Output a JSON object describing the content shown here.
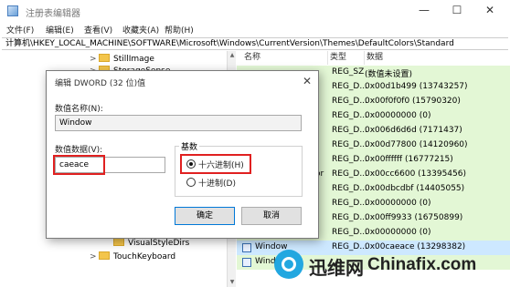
{
  "window": {
    "title": "注册表编辑器"
  },
  "menu": [
    "文件(F)",
    "编辑(E)",
    "查看(V)",
    "收藏夹(A)",
    "帮助(H)"
  ],
  "address": "计算机\\HKEY_LOCAL_MACHINE\\SOFTWARE\\Microsoft\\Windows\\CurrentVersion\\Themes\\DefaultColors\\Standard",
  "tree": {
    "items": [
      {
        "label": "StillImage",
        "expander": ">"
      },
      {
        "label": "StorageSense",
        "expander": ">"
      },
      {
        "label": "VisualStyleDirs",
        "expander": ""
      },
      {
        "label": "TouchKeyboard",
        "expander": ">"
      }
    ]
  },
  "values": {
    "headers": {
      "name": "名称",
      "type": "类型",
      "data": "数据"
    },
    "rows": [
      {
        "name": "",
        "type": "REG_SZ",
        "data": "(数值未设置)"
      },
      {
        "name": "",
        "type": "REG_D...",
        "data": "0x00d1b499 (13743257)"
      },
      {
        "name": "",
        "type": "REG_D...",
        "data": "0x00f0f0f0 (15790320)"
      },
      {
        "name": "",
        "type": "REG_D...",
        "data": "0x00000000 (0)"
      },
      {
        "name": "",
        "type": "REG_D...",
        "data": "0x006d6d6d (7171437)"
      },
      {
        "name": "",
        "type": "REG_D...",
        "data": "0x00d77800 (14120960)"
      },
      {
        "name": "",
        "type": "REG_D...",
        "data": "0x00ffffff (16777215)"
      },
      {
        "name": "olor",
        "type": "REG_D...",
        "data": "0x00cc6600 (13395456)"
      },
      {
        "name": "",
        "type": "REG_D...",
        "data": "0x00dbcdbf (14405055)"
      },
      {
        "name": "xt",
        "type": "REG_D...",
        "data": "0x00000000 (0)"
      },
      {
        "name": "",
        "type": "REG_D...",
        "data": "0x00ff9933 (16750899)"
      },
      {
        "name": "",
        "type": "REG_D...",
        "data": "0x00000000 (0)"
      },
      {
        "name": "Window",
        "type": "REG_D...",
        "data": "0x00caeace (13298382)"
      },
      {
        "name": "Window",
        "type": "",
        "data": ""
      }
    ]
  },
  "dialog": {
    "title": "编辑 DWORD (32 位)值",
    "value_name_label": "数值名称(N):",
    "value_name": "Window",
    "value_data_label": "数值数据(V):",
    "value_data": "caeace",
    "base_label": "基数",
    "hex_label": "十六进制(H)",
    "dec_label": "十进制(D)",
    "ok_label": "确定",
    "cancel_label": "取消"
  },
  "watermark": {
    "cn": "迅维网",
    "en": "Chinafix.com"
  },
  "colors": {
    "highlight": "#e02020",
    "value_row_bg": "#e3f7d5",
    "watermark_blue": "#22a7e0"
  }
}
